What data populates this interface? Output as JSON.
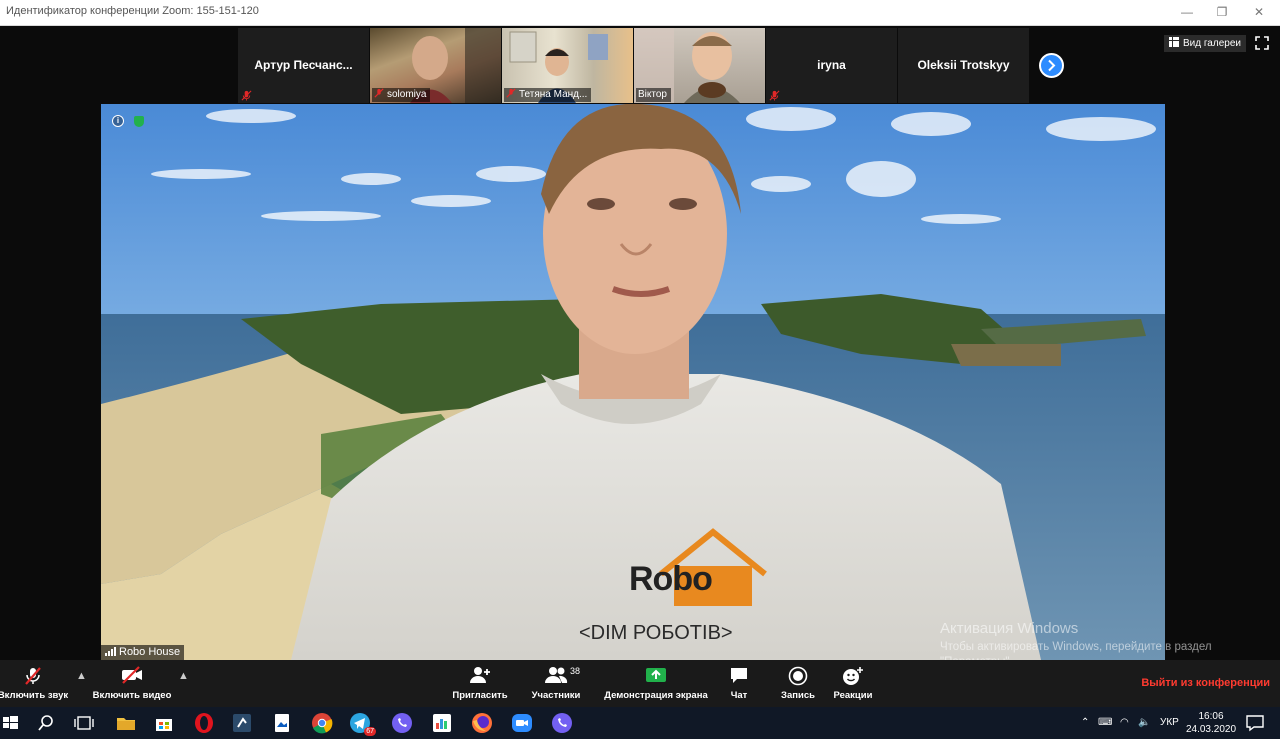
{
  "window": {
    "title": "Идентификатор конференции Zoom: 155-151-120",
    "controls": {
      "minimize": "—",
      "maximize": "❐",
      "close": "✕"
    }
  },
  "thumbnails": [
    {
      "name": "Артур  Песчанс...",
      "video": false,
      "muted": true
    },
    {
      "name": "solomiya",
      "video": true,
      "muted": true
    },
    {
      "name": "Тетяна Манд...",
      "video": true,
      "muted": true
    },
    {
      "name": "Віктор",
      "video": true,
      "muted": false
    },
    {
      "name": "iryna",
      "video": false,
      "muted": true
    },
    {
      "name": "Oleksii Trotskyy",
      "video": false,
      "muted": false
    }
  ],
  "gallery_view_label": "Вид галереи",
  "main_video": {
    "speaker_label": "Robo House",
    "shirt_logo": "Robo",
    "shirt_text": "<DIM РОБОТІВ>"
  },
  "activation_watermark": {
    "line1": "Активация Windows",
    "line2": "Чтобы активировать Windows, перейдите в раздел \"Параметры\"."
  },
  "toolbar": {
    "unmute_label": "Включить звук",
    "video_label": "Включить видео",
    "invite_label": "Пригласить",
    "participants_label": "Участники",
    "participants_count": "38",
    "share_label": "Демонстрация экрана",
    "chat_label": "Чат",
    "record_label": "Запись",
    "reactions_label": "Реакции",
    "leave_label": "Выйти из конференции"
  },
  "taskbar": {
    "language": "УКР",
    "time": "16:06",
    "date": "24.03.2020",
    "telegram_badge": "67"
  },
  "colors": {
    "accent": "#2d8cff",
    "leave": "#ff3b30",
    "share_green": "#21b14b",
    "muted_red": "#e02828"
  }
}
